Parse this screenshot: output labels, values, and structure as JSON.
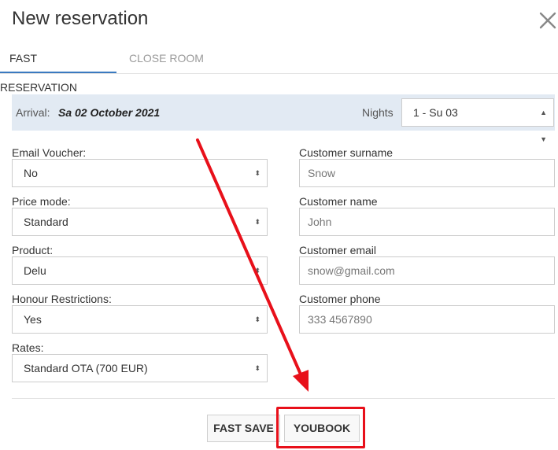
{
  "dialog": {
    "title": "New reservation"
  },
  "tabs": [
    {
      "label": "FAST RESERVATION",
      "active": true
    },
    {
      "label": "CLOSE ROOM",
      "active": false
    }
  ],
  "arrival": {
    "label": "Arrival:",
    "date": "Sa 02 October 2021",
    "nights_label": "Nights",
    "nights_value": "1 - Su 03"
  },
  "left_fields": [
    {
      "label": "Email Voucher:",
      "value": "No"
    },
    {
      "label": "Price mode:",
      "value": "Standard"
    },
    {
      "label": "Product:",
      "value": "Delu"
    },
    {
      "label": "Honour Restrictions:",
      "value": "Yes"
    },
    {
      "label": "Rates:",
      "value": "Standard OTA (700 EUR)"
    }
  ],
  "right_fields": [
    {
      "label": "Customer surname",
      "value": "Snow"
    },
    {
      "label": "Customer name",
      "value": "John"
    },
    {
      "label": "Customer email",
      "value": "snow@gmail.com"
    },
    {
      "label": "Customer phone",
      "value": "333 4567890"
    }
  ],
  "buttons": {
    "fast_save": "FAST SAVE",
    "youbook": "YOUBOOK"
  },
  "colors": {
    "accent": "#3a7ac0",
    "annotation": "#e8101a",
    "arrival_bg": "#e2eaf3"
  }
}
